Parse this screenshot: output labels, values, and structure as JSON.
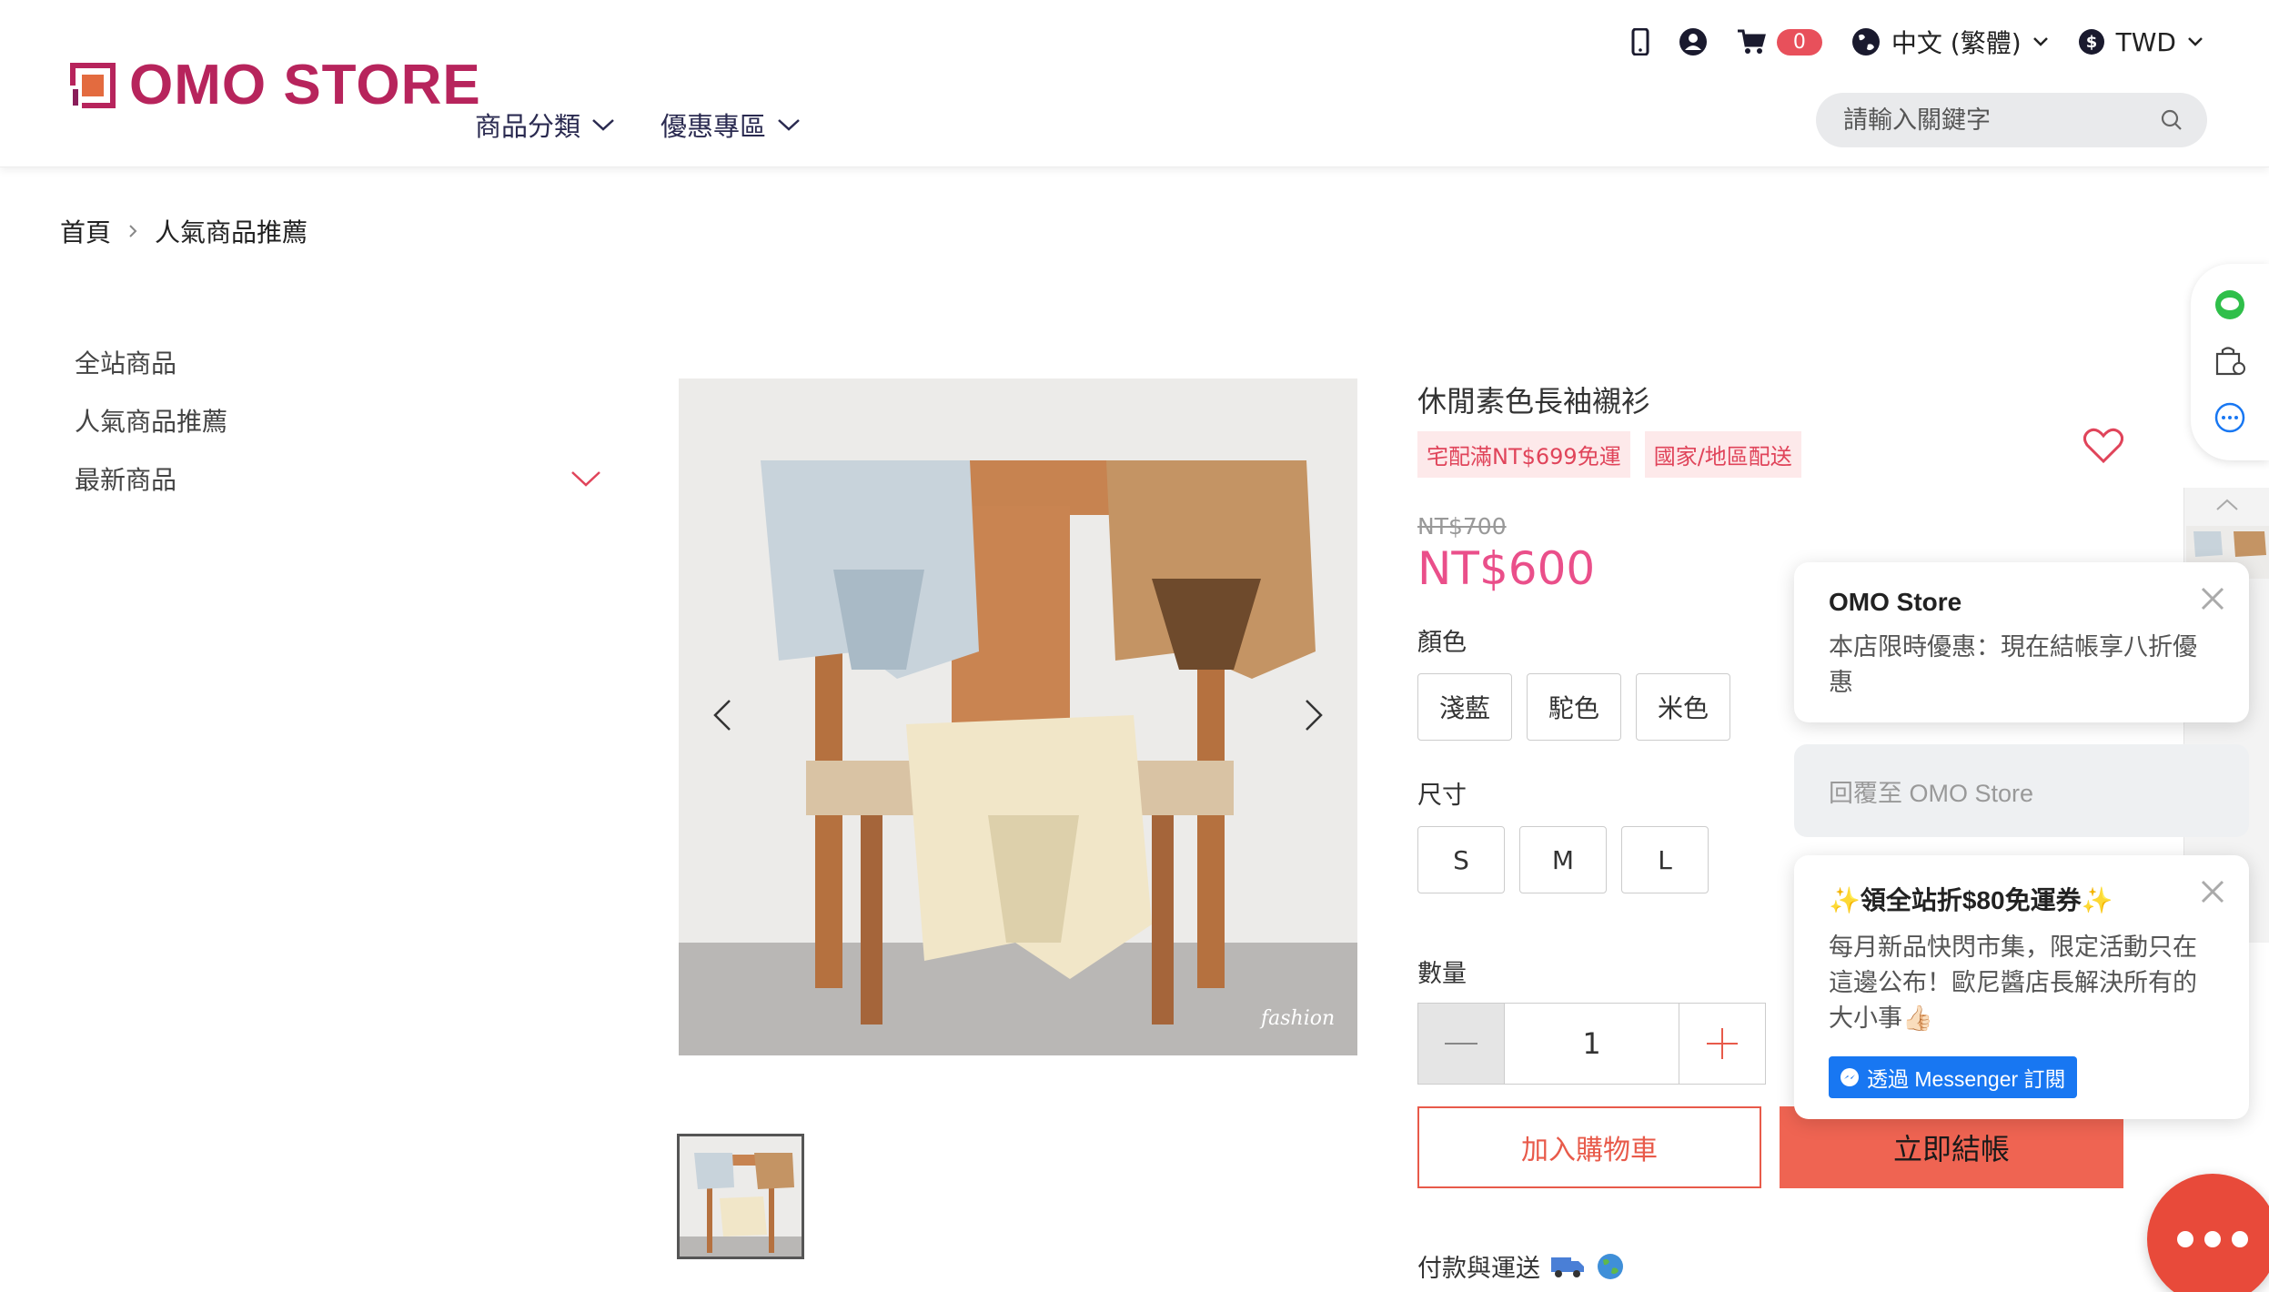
{
  "header": {
    "logo_text": "OMO STORE",
    "nav": [
      {
        "label": "商品分類"
      },
      {
        "label": "優惠專區"
      }
    ],
    "util": {
      "phone_icon": "mobile-phone-icon",
      "account_icon": "user-account-icon",
      "cart_icon": "shopping-cart-icon",
      "cart_count": "0",
      "language_icon": "globe-icon",
      "language": "中文 (繁體)",
      "currency_icon": "dollar-icon",
      "currency": "TWD"
    },
    "search_placeholder": "請輸入關鍵字"
  },
  "breadcrumb": {
    "home": "首頁",
    "current": "人氣商品推薦"
  },
  "sidebar": {
    "items": [
      {
        "label": "全站商品"
      },
      {
        "label": "人氣商品推薦"
      },
      {
        "label": "最新商品"
      }
    ]
  },
  "product": {
    "title": "休閒素色長袖襯衫",
    "tags": [
      "宅配滿NT$699免運",
      "國家/地區配送"
    ],
    "original_price": "NT$700",
    "price": "NT$600",
    "color_label": "顏色",
    "colors": [
      "淺藍",
      "駝色",
      "米色"
    ],
    "size_label": "尺寸",
    "sizes": [
      "S",
      "M",
      "L"
    ],
    "qty_label": "數量",
    "qty": "1",
    "add_to_cart": "加入購物車",
    "buy_now": "立即結帳",
    "payment_shipping": "付款與運送"
  },
  "chat": {
    "popup1_title": "OMO Store",
    "popup1_text": "本店限時優惠：現在結帳享八折優惠",
    "reply_placeholder": "回覆至 OMO Store",
    "popup2_title": "✨領全站折$80免運券✨",
    "popup2_text": "每月新品快閃市集，限定活動只在這邊公布！歐尼醬店長解決所有的大小事👍🏻",
    "messenger_button": "透過 Messenger 訂閱"
  },
  "colors": {
    "brand": "#b7245c",
    "price": "#ea4f8a",
    "accent": "#ef6452",
    "tag_bg": "#fde9ea"
  }
}
